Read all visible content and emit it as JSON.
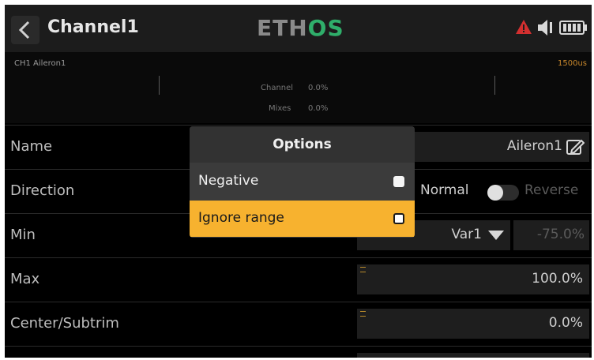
{
  "header": {
    "title": "Channel1",
    "logo_prefix": "ETH",
    "logo_suffix": "OS"
  },
  "monitor": {
    "channel_label": "CH1  Aileron1",
    "output_value": "1500us",
    "channel_row_label": "Channel",
    "channel_row_value": "0.0%",
    "mixes_row_label": "Mixes",
    "mixes_row_value": "0.0%"
  },
  "rows": {
    "name": {
      "label": "Name",
      "value": "Aileron1"
    },
    "direction": {
      "label": "Direction",
      "normal": "Normal",
      "reverse": "Reverse"
    },
    "min": {
      "label": "Min",
      "source": "Var1",
      "value": "-75.0%"
    },
    "max": {
      "label": "Max",
      "value": "100.0%"
    },
    "center": {
      "label": "Center/Subtrim",
      "value": "0.0%"
    }
  },
  "dialog": {
    "title": "Options",
    "options": [
      {
        "label": "Negative",
        "checked": false
      },
      {
        "label": "Ignore range",
        "checked": false
      }
    ]
  },
  "colors": {
    "accent": "#f7b22f",
    "alert": "#d32f2f",
    "logo_green": "#2fae6a"
  }
}
